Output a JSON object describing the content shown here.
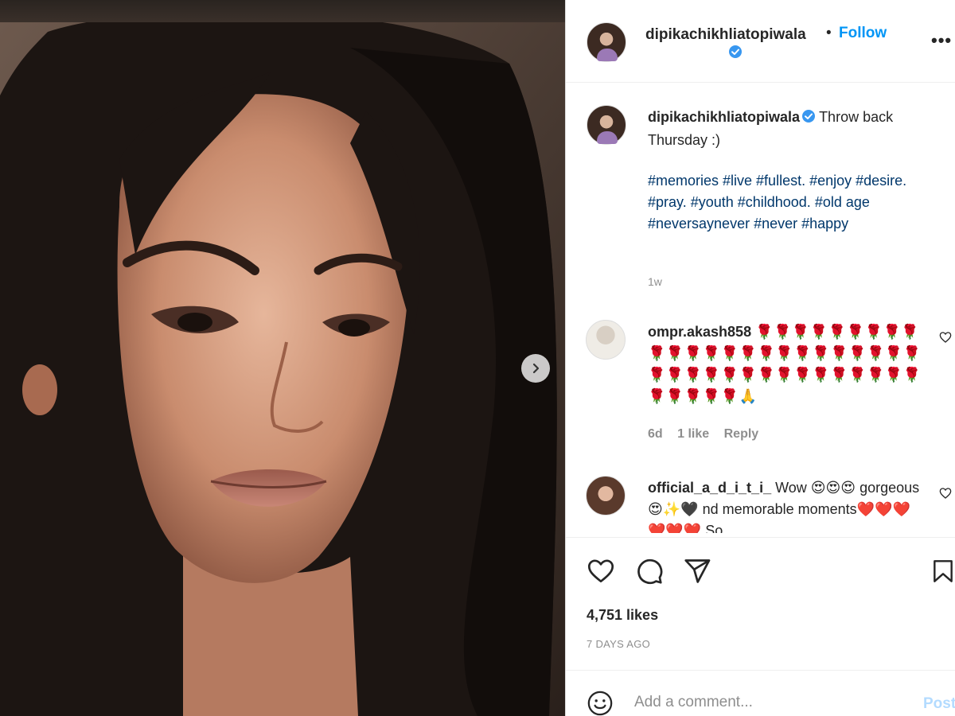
{
  "post": {
    "username": "dipikachikhliatopiwala",
    "dot": "•",
    "follow_label": "Follow",
    "more_label": "•••"
  },
  "caption": {
    "username": "dipikachikhliatopiwala",
    "text": "Throw back Thursday :)",
    "hashtags": "#memories #live #fullest. #enjoy #desire. #pray. #youth #childhood. #old age #neversaynever #never #happy",
    "time": "1w"
  },
  "comments": [
    {
      "username": "ompr.akash858",
      "text": "🌹🌹🌹🌹🌹🌹🌹🌹🌹🌹🌹🌹🌹🌹🌹🌹🌹🌹🌹🌹🌹🌹🌹🌹🌹🌹🌹🌹🌹🌹🌹🌹🌹🌹🌹🌹🌹🌹🌹🌹🌹🌹🌹🌹🙏",
      "time": "6d",
      "likes": "1 like",
      "reply": "Reply"
    },
    {
      "username": "official_a_d_i_t_i_",
      "text": "Wow 😍😍😍 gorgeous😍✨🖤 nd memorable moments❤️❤️❤️❤️❤️❤️ So"
    }
  ],
  "stats": {
    "likes": "4,751 likes",
    "posted_ago": "7 DAYS AGO"
  },
  "composer": {
    "placeholder": "Add a comment...",
    "post_label": "Post"
  },
  "icons": {
    "like": "heart-icon",
    "comment": "comment-icon",
    "share": "paper-plane-icon",
    "save": "bookmark-icon",
    "emoji": "smiley-icon",
    "verified": "verified-badge-icon",
    "next": "chevron-right-icon"
  },
  "colors": {
    "link": "#0095f6",
    "hashtag": "#00376b",
    "muted": "#8e8e8e",
    "verified": "#3897f0"
  }
}
